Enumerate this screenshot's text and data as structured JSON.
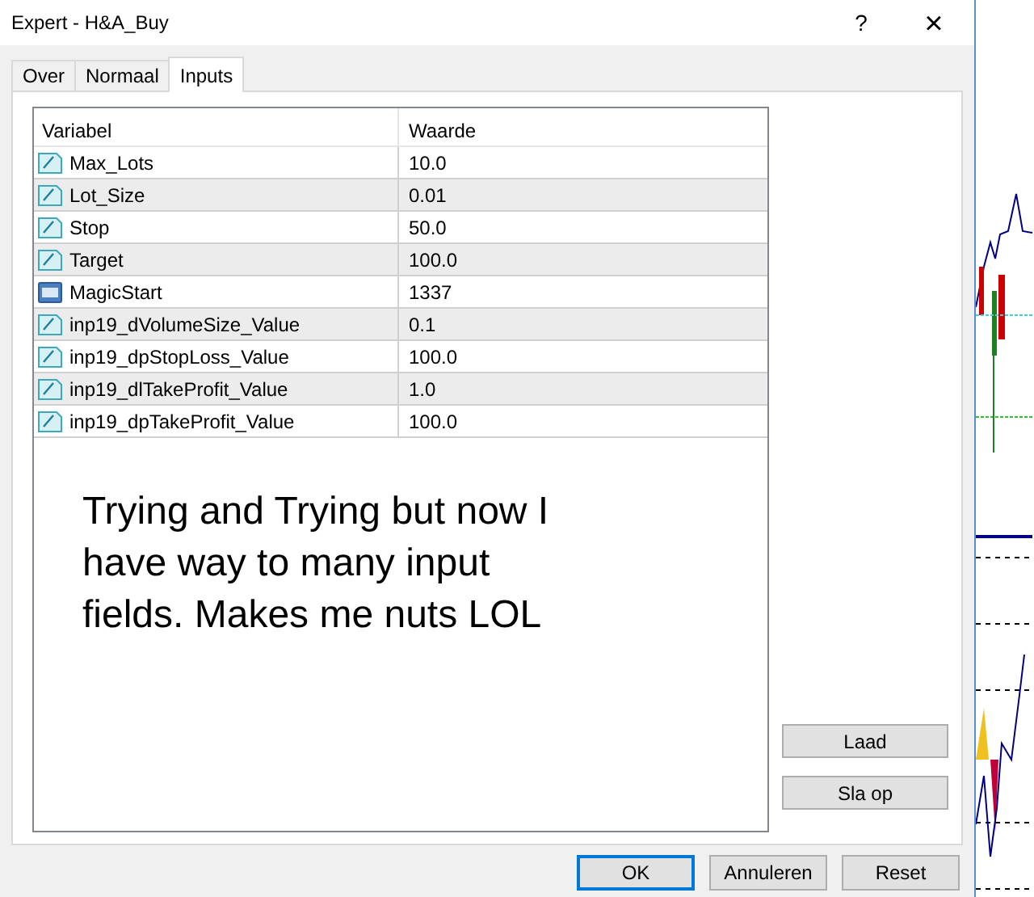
{
  "window": {
    "title": "Expert - H&A_Buy",
    "help": "?",
    "close": "×"
  },
  "tabs": [
    {
      "label": "Over",
      "selected": false
    },
    {
      "label": "Normaal",
      "selected": false
    },
    {
      "label": "Inputs",
      "selected": true
    }
  ],
  "table": {
    "columns": [
      "Variabel",
      "Waarde"
    ],
    "rows": [
      {
        "kind": "double",
        "name": "Max_Lots",
        "value": "10.0"
      },
      {
        "kind": "double",
        "name": "Lot_Size",
        "value": "0.01"
      },
      {
        "kind": "double",
        "name": "Stop",
        "value": "50.0"
      },
      {
        "kind": "double",
        "name": "Target",
        "value": "100.0"
      },
      {
        "kind": "int",
        "name": "MagicStart",
        "value": "1337"
      },
      {
        "kind": "double",
        "name": "inp19_dVolumeSize_Value",
        "value": "0.1"
      },
      {
        "kind": "double",
        "name": "inp19_dpStopLoss_Value",
        "value": "100.0"
      },
      {
        "kind": "double",
        "name": "inp19_dlTakeProfit_Value",
        "value": "1.0"
      },
      {
        "kind": "double",
        "name": "inp19_dpTakeProfit_Value",
        "value": "100.0"
      }
    ],
    "note": "Trying and Trying but now I have way to many input fields. Makes me nuts LOL"
  },
  "side_buttons": [
    "Laad",
    "Sla op"
  ],
  "buttons": [
    {
      "label": "OK",
      "default": true
    },
    {
      "label": "Annuleren",
      "default": false
    },
    {
      "label": "Reset",
      "default": false
    }
  ]
}
